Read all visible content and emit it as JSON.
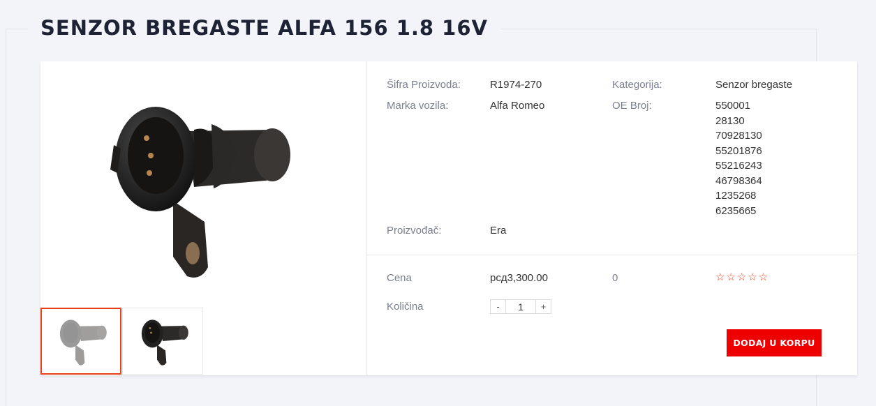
{
  "product": {
    "title": "SENZOR BREGASTE ALFA 156 1.8 16V",
    "details": {
      "sku_label": "Šifra Proizvoda:",
      "sku_value": "R1974-270",
      "brand_label": "Marka vozila:",
      "brand_value": "Alfa Romeo",
      "category_label": "Kategorija:",
      "category_value": "Senzor bregaste",
      "oe_label": "OE Broj:",
      "oe_numbers": [
        "550001",
        "28130",
        "70928130",
        "55201876",
        "55216243",
        "46798364",
        "1235268",
        "6235665"
      ],
      "manufacturer_label": "Proizvođač:",
      "manufacturer_value": "Era"
    },
    "purchase": {
      "price_label": "Cena",
      "price_value": "рсд3,300.00",
      "rating_count": "0",
      "rating_stars": "☆☆☆☆☆",
      "quantity_label": "Količina",
      "qty_minus": "-",
      "qty_plus": "+",
      "quantity_value": "1",
      "add_to_cart_label": "DODAJ U KORPU"
    },
    "gallery": {
      "main_image_icon": "camshaft-sensor-image",
      "thumbnails": [
        "camshaft-sensor-thumb-1",
        "camshaft-sensor-thumb-2"
      ]
    }
  },
  "colors": {
    "accent_red": "#ee0000",
    "thumb_active_border": "#e8401c",
    "title_color": "#1e2235",
    "page_bg": "#f3f4f9"
  }
}
